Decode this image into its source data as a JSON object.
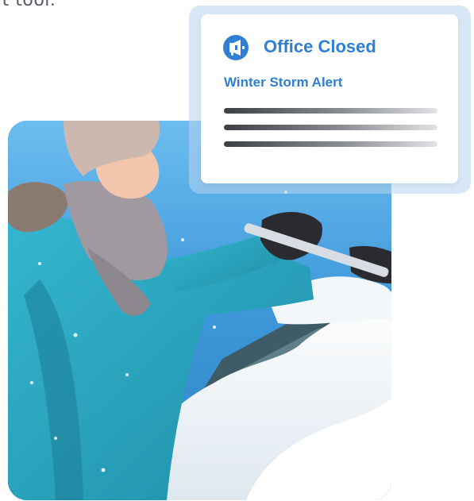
{
  "header": {
    "partial_text": "it tool."
  },
  "alert": {
    "title": "Office Closed",
    "subtitle": "Winter Storm Alert",
    "icon": "megaphone-icon",
    "accent_color": "#2f7fd3"
  },
  "photo": {
    "description_icon": "woman-scraping-snow-photo"
  }
}
